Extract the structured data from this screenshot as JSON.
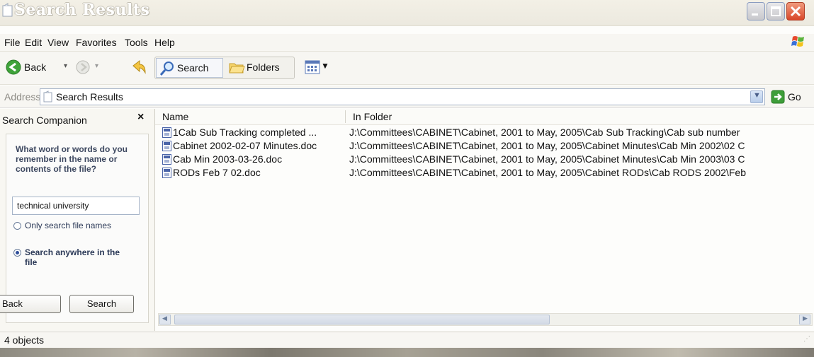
{
  "window": {
    "title": "Search Results",
    "accent_color": "#0a246a"
  },
  "menu": [
    "File",
    "Edit",
    "View",
    "Favorites",
    "Tools",
    "Help"
  ],
  "toolbar": {
    "back_label": "Back",
    "search_label": "Search",
    "folders_label": "Folders"
  },
  "address": {
    "label": "Address",
    "value": "Search Results",
    "go_label": "Go"
  },
  "companion": {
    "title": "Search Companion",
    "close_glyph": "×",
    "prompt": "What word or words do you remember in the name or contents of the file?",
    "query": "technical university",
    "options": [
      {
        "label": "Only search file names",
        "checked": false
      },
      {
        "label": "Search anywhere in the file",
        "checked": true
      }
    ],
    "back_button": "Back",
    "search_button": "Search"
  },
  "results": {
    "columns": [
      "Name",
      "In Folder"
    ],
    "rows": [
      {
        "name": "1Cab Sub Tracking completed ...",
        "folder": "J:\\Committees\\CABINET\\Cabinet, 2001 to May, 2005\\Cab Sub Tracking\\Cab sub number"
      },
      {
        "name": "Cabinet 2002-02-07 Minutes.doc",
        "folder": "J:\\Committees\\CABINET\\Cabinet, 2001 to May, 2005\\Cabinet Minutes\\Cab Min 2002\\02 C"
      },
      {
        "name": "Cab Min 2003-03-26.doc",
        "folder": "J:\\Committees\\CABINET\\Cabinet, 2001 to May, 2005\\Cabinet Minutes\\Cab Min 2003\\03 C"
      },
      {
        "name": "RODs Feb 7 02.doc",
        "folder": "J:\\Committees\\CABINET\\Cabinet, 2001 to May, 2005\\Cabinet RODs\\Cab RODS 2002\\Feb"
      }
    ]
  },
  "status": {
    "text": "4 objects"
  }
}
